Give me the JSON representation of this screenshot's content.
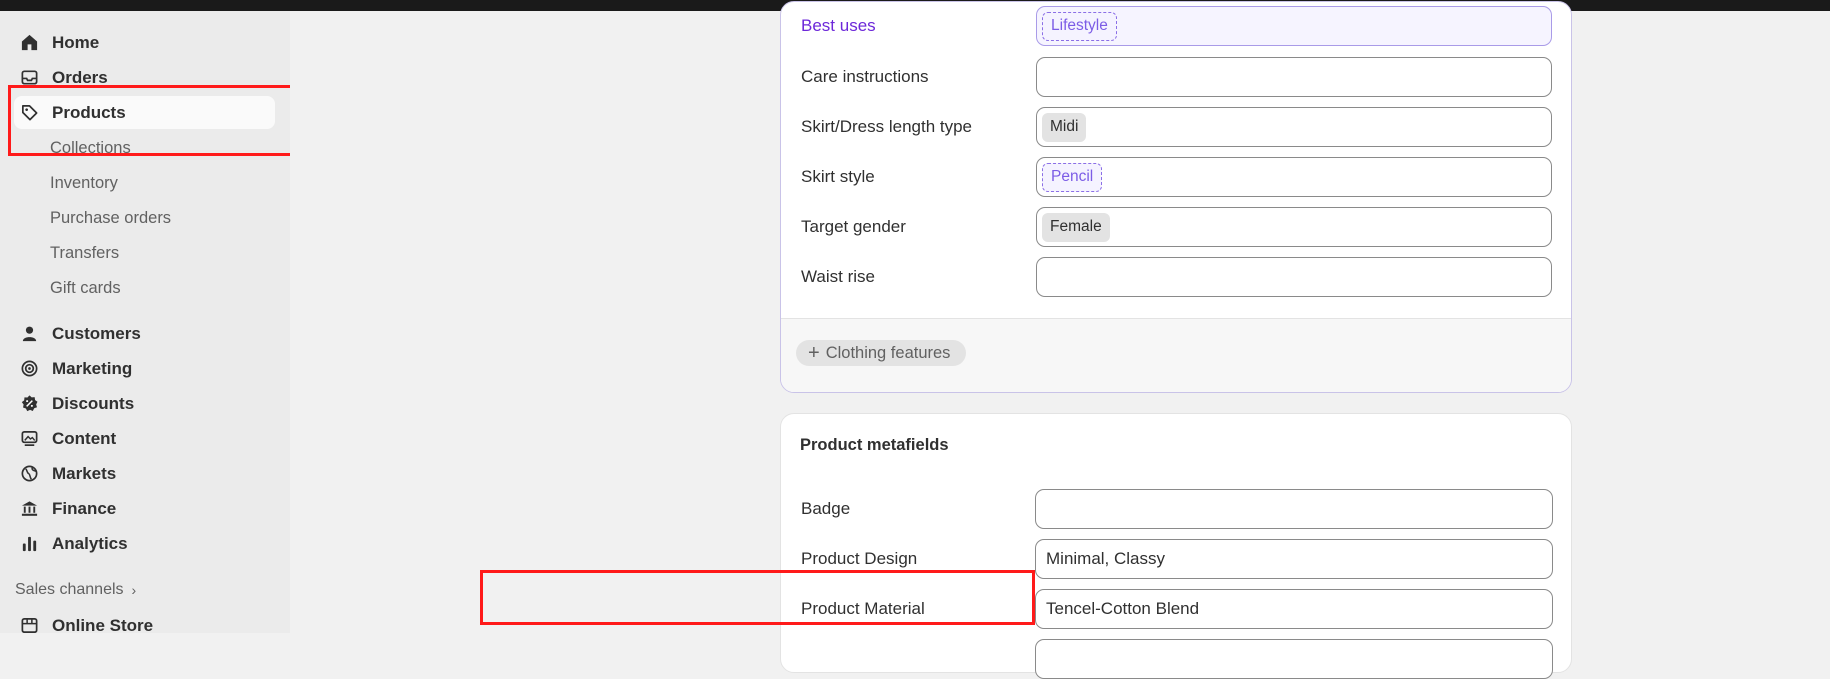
{
  "sidebar": {
    "items": [
      {
        "label": "Home",
        "icon": "home-icon"
      },
      {
        "label": "Orders",
        "icon": "inbox-icon"
      },
      {
        "label": "Products",
        "icon": "tag-icon",
        "active": true
      }
    ],
    "product_sub": [
      "Collections",
      "Inventory",
      "Purchase orders",
      "Transfers",
      "Gift cards"
    ],
    "items2": [
      {
        "label": "Customers",
        "icon": "person-icon"
      },
      {
        "label": "Marketing",
        "icon": "target-icon"
      },
      {
        "label": "Discounts",
        "icon": "discount-icon"
      },
      {
        "label": "Content",
        "icon": "image-icon"
      },
      {
        "label": "Markets",
        "icon": "globe-icon"
      },
      {
        "label": "Finance",
        "icon": "bank-icon"
      },
      {
        "label": "Analytics",
        "icon": "bar-chart-icon"
      }
    ],
    "sales_channels_label": "Sales channels",
    "online_store_label": "Online Store"
  },
  "category_metafields": {
    "rows": [
      {
        "label": "Best uses",
        "tag": "Lifestyle",
        "style": "dashed"
      },
      {
        "label": "Care instructions",
        "tag": ""
      },
      {
        "label": "Skirt/Dress length type",
        "tag": "Midi",
        "style": "solid"
      },
      {
        "label": "Skirt style",
        "tag": "Pencil",
        "style": "dashed"
      },
      {
        "label": "Target gender",
        "tag": "Female",
        "style": "solid"
      },
      {
        "label": "Waist rise",
        "tag": ""
      }
    ],
    "add_button_label": "Clothing features"
  },
  "product_metafields": {
    "title": "Product metafields",
    "rows": [
      {
        "label": "Badge",
        "value": ""
      },
      {
        "label": "Product Design",
        "value": "Minimal, Classy"
      },
      {
        "label": "Product Material",
        "value": "Tencel-Cotton Blend"
      }
    ]
  },
  "colors": {
    "highlight": "#ff1a1a",
    "accent_purple": "#6d28d9"
  }
}
